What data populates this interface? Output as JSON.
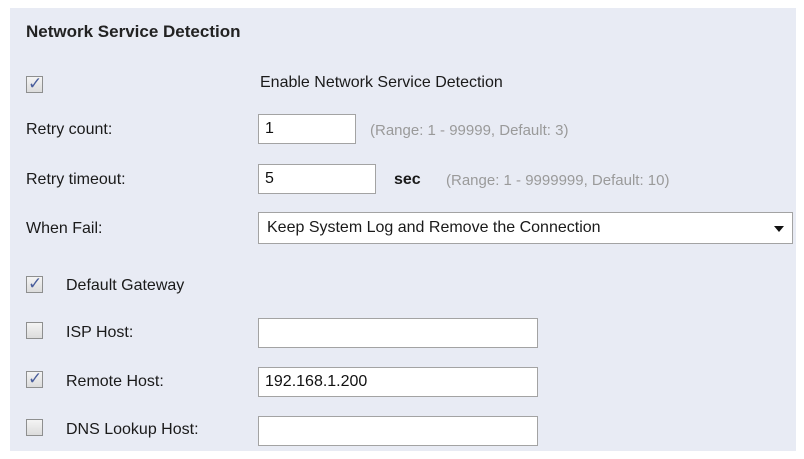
{
  "section": {
    "title": "Network Service Detection"
  },
  "enable": {
    "checked": true,
    "label": "Enable Network Service Detection"
  },
  "retry_count": {
    "label": "Retry count:",
    "value": "1",
    "hint": "(Range: 1 - 99999, Default: 3)"
  },
  "retry_timeout": {
    "label": "Retry timeout:",
    "value": "5",
    "unit": "sec",
    "hint": "(Range: 1 - 9999999, Default: 10)"
  },
  "when_fail": {
    "label": "When Fail:",
    "selected": "Keep System Log and Remove the Connection"
  },
  "default_gateway": {
    "checked": true,
    "label": "Default Gateway"
  },
  "isp_host": {
    "checked": false,
    "label": "ISP Host:",
    "value": ""
  },
  "remote_host": {
    "checked": true,
    "label": "Remote Host:",
    "value": "192.168.1.200"
  },
  "dns_lookup_host": {
    "checked": false,
    "label": "DNS Lookup Host:",
    "value": ""
  },
  "colors": {
    "panel_bg": "#e8ebf4",
    "checkmark": "#4b5f9c",
    "hint": "#9a9a9a"
  }
}
